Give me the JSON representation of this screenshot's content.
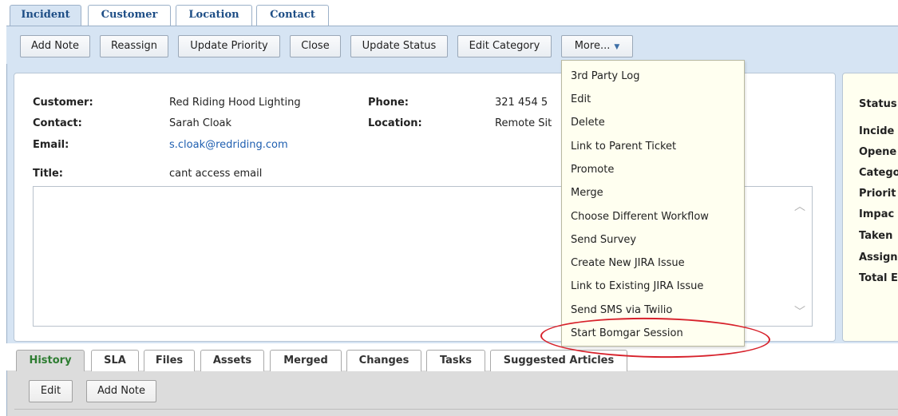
{
  "top_tabs": [
    "Incident",
    "Customer",
    "Location",
    "Contact"
  ],
  "toolbar": {
    "add_note": "Add Note",
    "reassign": "Reassign",
    "update_priority": "Update Priority",
    "close": "Close",
    "update_status": "Update Status",
    "edit_category": "Edit Category",
    "more": "More...",
    "more_caret_icon": "caret-down-icon"
  },
  "details": {
    "customer_label": "Customer:",
    "customer_value": "Red Riding Hood Lighting",
    "contact_label": "Contact:",
    "contact_value": "Sarah Cloak",
    "email_label": "Email:",
    "email_value": "s.cloak@redriding.com",
    "title_label": "Title:",
    "title_value": "cant access email",
    "phone_label": "Phone:",
    "phone_value": "321 454 5",
    "location_label": "Location:",
    "location_value": "Remote Sit"
  },
  "side_panel": {
    "status": "Status",
    "incident": "Incide",
    "opened": "Opene",
    "category": "Catego",
    "priority": "Priorit",
    "impact": "Impac",
    "taken": "Taken",
    "assigned": "Assign",
    "total": "Total E"
  },
  "more_menu": {
    "items": [
      "3rd Party Log",
      "Edit",
      "Delete",
      "Link to Parent Ticket",
      "Promote",
      "Merge",
      "Choose Different Workflow",
      "Send Survey",
      "Create New JIRA Issue",
      "Link to Existing JIRA Issue",
      "Send SMS via Twilio",
      "Start Bomgar Session"
    ],
    "highlighted_item": "Start Bomgar Session"
  },
  "bottom_tabs": [
    "History",
    "SLA",
    "Files",
    "Assets",
    "Merged",
    "Changes",
    "Tasks",
    "Suggested Articles"
  ],
  "history_toolbar": {
    "edit": "Edit",
    "add_note": "Add Note"
  },
  "colors": {
    "panel_blue": "#d6e4f3",
    "tab_text": "#1e4e86",
    "menu_bg": "#fffff0",
    "highlight_red": "#d7212b",
    "active_green": "#2e7d32"
  }
}
